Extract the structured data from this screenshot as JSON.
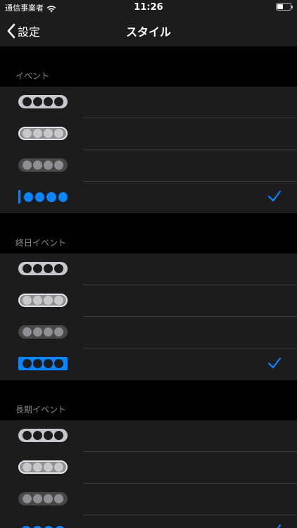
{
  "status": {
    "carrier": "通信事業者",
    "time": "11:26",
    "battery_level": 0.45
  },
  "nav": {
    "back_label": "設定",
    "title": "スタイル"
  },
  "sections": [
    {
      "header": "イベント",
      "selected_index": 3
    },
    {
      "header": "終日イベント",
      "selected_index": 3
    },
    {
      "header": "長期イベント",
      "selected_index": 3
    }
  ],
  "icons": {
    "back": "chevron-left-icon",
    "wifi": "wifi-icon",
    "battery": "battery-icon",
    "check": "checkmark-icon"
  },
  "colors": {
    "accent": "#0a84ff",
    "background": "#000000",
    "group_background": "#1c1c1e",
    "header_text": "#8e8e93"
  }
}
